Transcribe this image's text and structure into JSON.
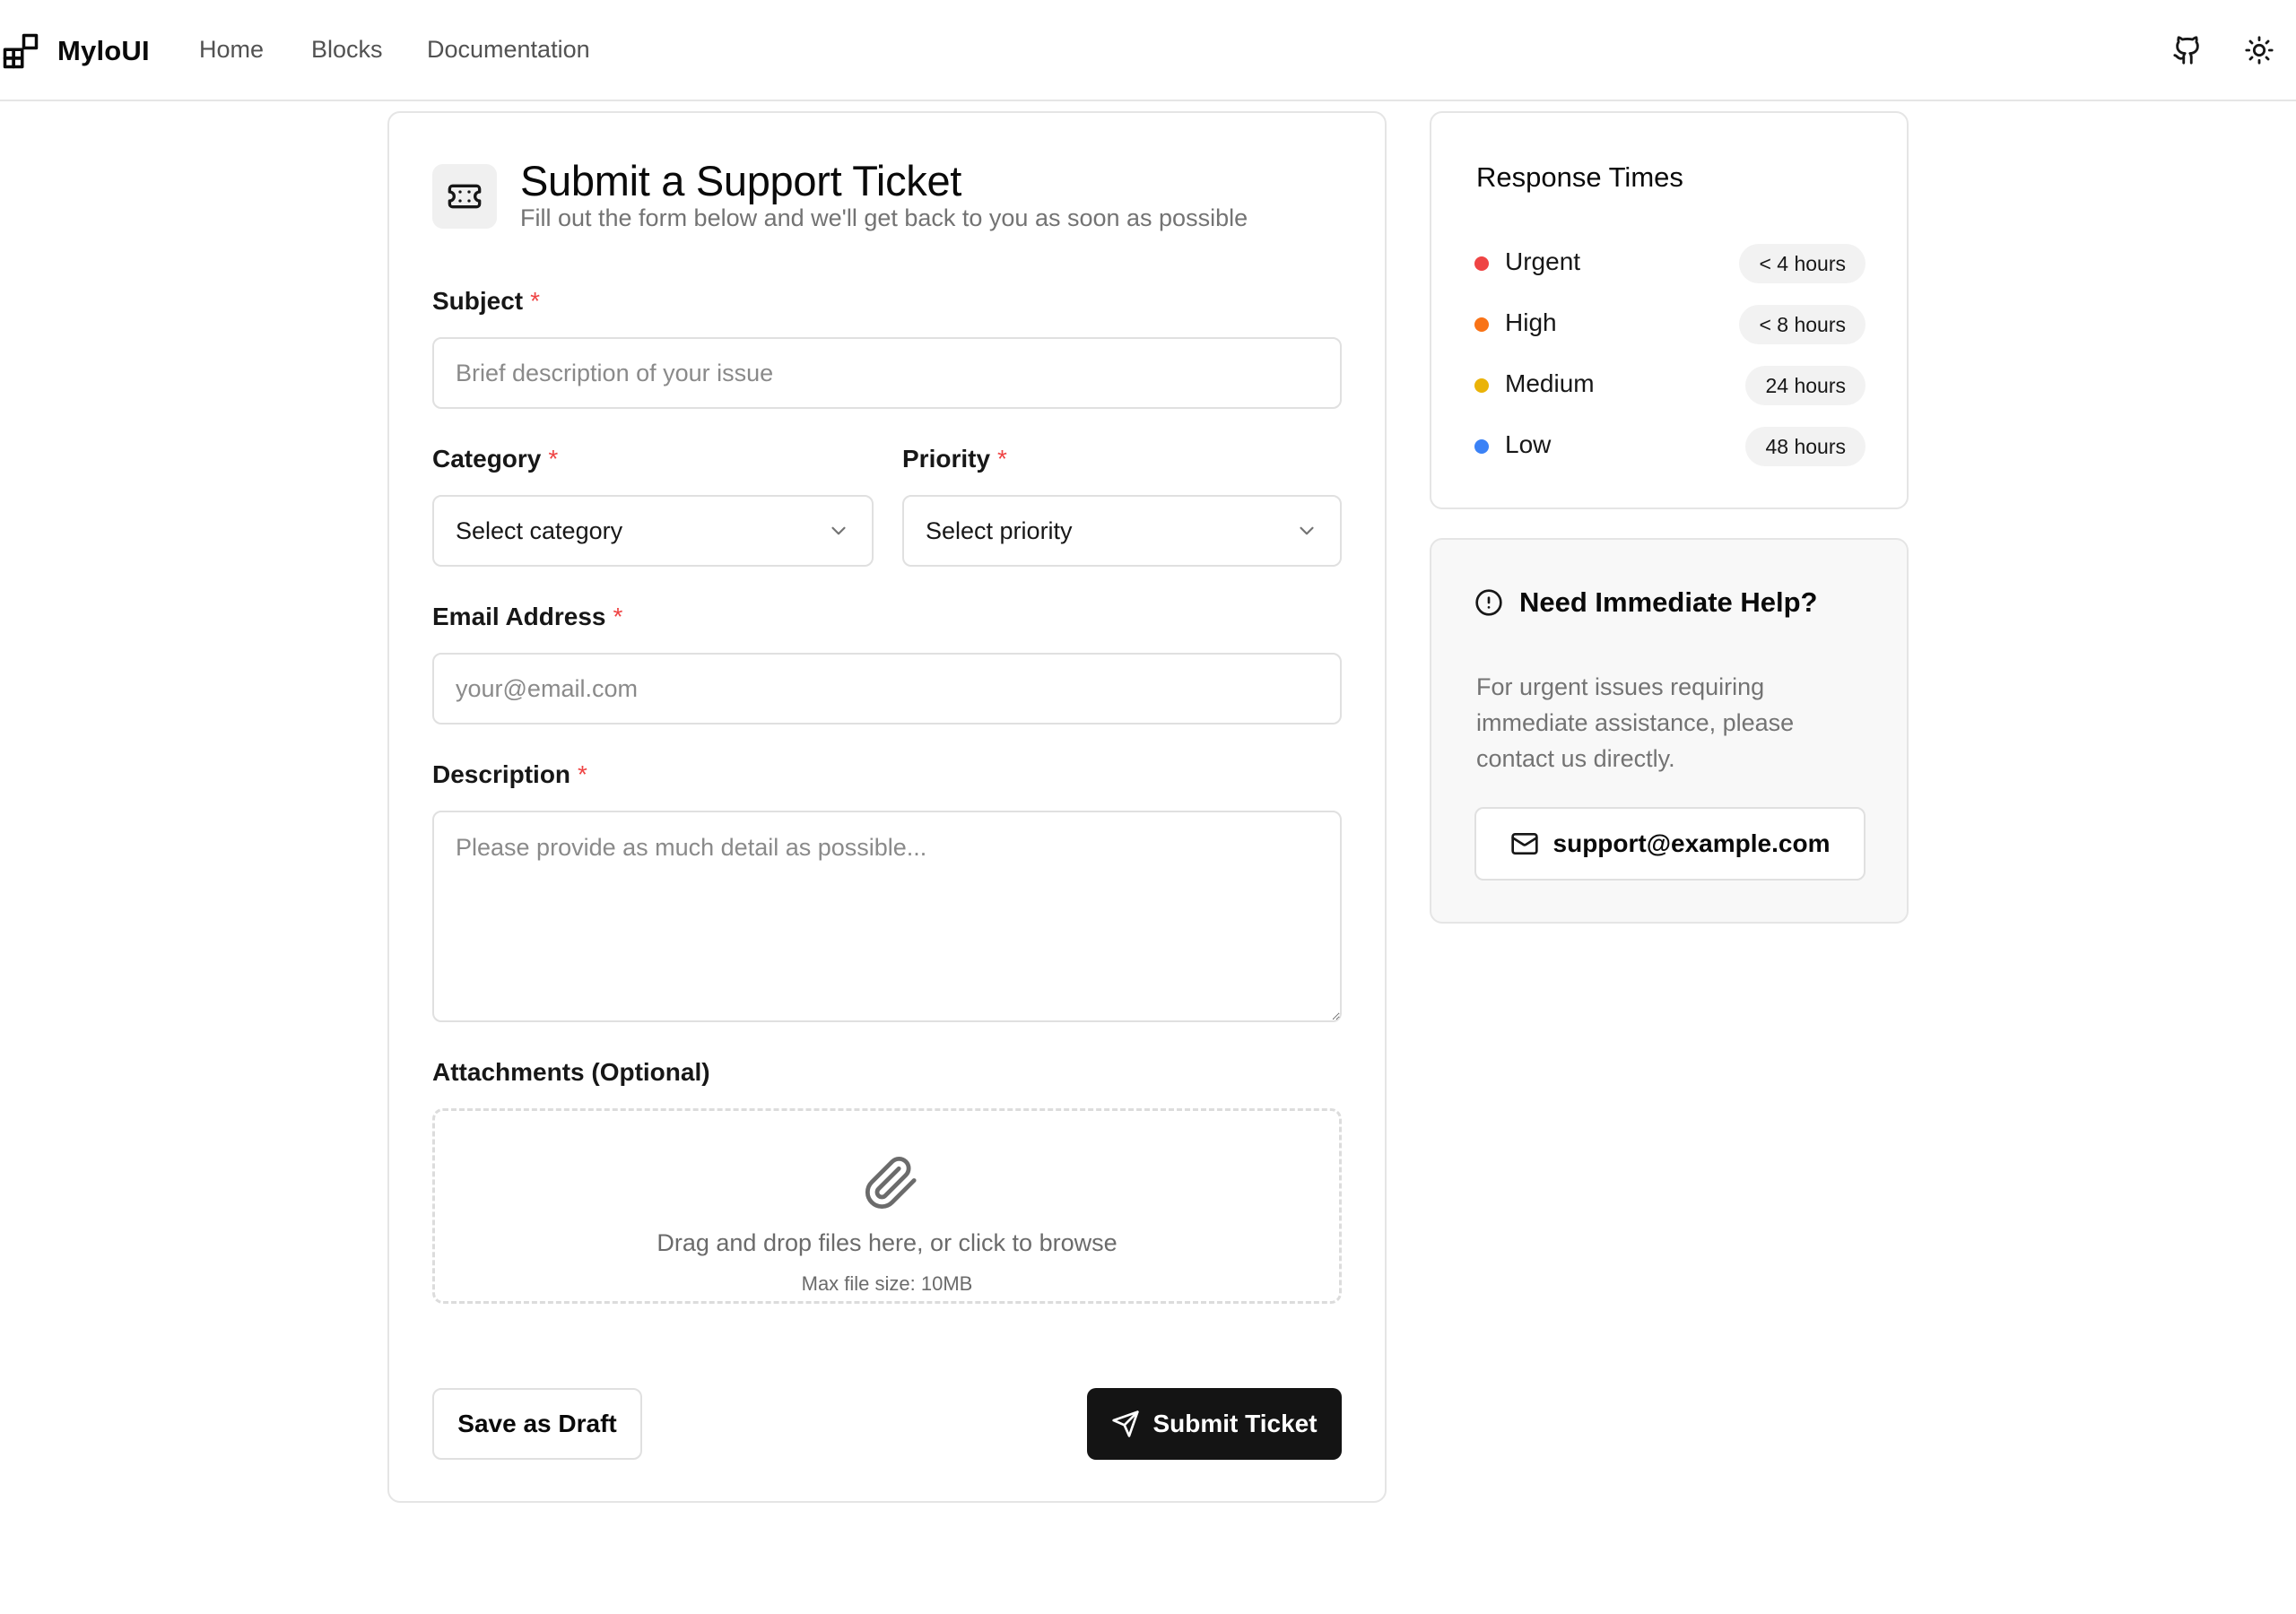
{
  "nav": {
    "brand": "MyloUI",
    "links": [
      {
        "label": "Home"
      },
      {
        "label": "Blocks"
      },
      {
        "label": "Documentation"
      }
    ],
    "icons": {
      "brand": "blocks-icon",
      "github": "github-icon",
      "theme": "sun-icon"
    }
  },
  "form": {
    "icon": "ticket-icon",
    "title": "Submit a Support Ticket",
    "subtitle": "Fill out the form below and we'll get back to you as soon as possible",
    "required_marker": "*",
    "subject": {
      "label": "Subject",
      "value": "",
      "placeholder": "Brief description of your issue"
    },
    "category": {
      "label": "Category",
      "selected": "Select category"
    },
    "priority": {
      "label": "Priority",
      "selected": "Select priority"
    },
    "email": {
      "label": "Email Address",
      "value": "",
      "placeholder": "your@email.com"
    },
    "description": {
      "label": "Description",
      "value": "",
      "placeholder": "Please provide as much detail as possible..."
    },
    "attachments": {
      "label": "Attachments (Optional)",
      "drop_text": "Drag and drop files here, or click to browse",
      "hint": "Max file size: 10MB",
      "icon": "paperclip-icon"
    },
    "save_draft_label": "Save as Draft",
    "submit_label": "Submit Ticket"
  },
  "response_times": {
    "title": "Response Times",
    "items": [
      {
        "label": "Urgent",
        "time": "< 4 hours",
        "color": "#ef4444"
      },
      {
        "label": "High",
        "time": "< 8 hours",
        "color": "#f97316"
      },
      {
        "label": "Medium",
        "time": "24 hours",
        "color": "#eab308"
      },
      {
        "label": "Low",
        "time": "48 hours",
        "color": "#3b82f6"
      }
    ]
  },
  "help": {
    "icon": "alert-circle-icon",
    "title": "Need Immediate Help?",
    "text": "For urgent issues requiring immediate assistance, please contact us directly.",
    "email": "support@example.com"
  }
}
